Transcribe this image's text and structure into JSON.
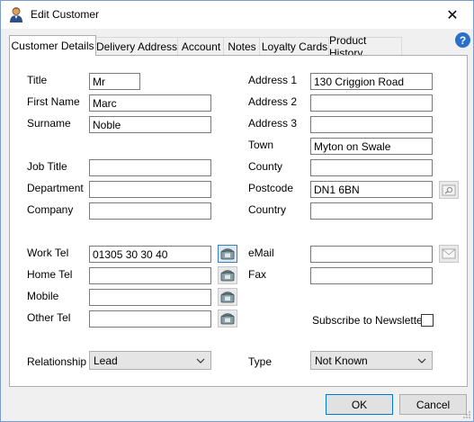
{
  "window": {
    "title": "Edit Customer",
    "close_glyph": "✕",
    "help_glyph": "?"
  },
  "tabs": [
    {
      "label": "Customer Details",
      "active": true
    },
    {
      "label": "Delivery Address"
    },
    {
      "label": "Account"
    },
    {
      "label": "Notes"
    },
    {
      "label": "Loyalty Cards"
    },
    {
      "label": "Product History"
    }
  ],
  "left_fields": {
    "title": {
      "label": "Title",
      "value": "Mr"
    },
    "first_name": {
      "label": "First Name",
      "value": "Marc"
    },
    "surname": {
      "label": "Surname",
      "value": "Noble"
    },
    "job_title": {
      "label": "Job Title",
      "value": ""
    },
    "department": {
      "label": "Department",
      "value": ""
    },
    "company": {
      "label": "Company",
      "value": ""
    },
    "work_tel": {
      "label": "Work Tel",
      "value": "01305 30 30 40"
    },
    "home_tel": {
      "label": "Home Tel",
      "value": ""
    },
    "mobile": {
      "label": "Mobile",
      "value": ""
    },
    "other_tel": {
      "label": "Other Tel",
      "value": ""
    },
    "relationship": {
      "label": "Relationship",
      "value": "Lead"
    }
  },
  "right_fields": {
    "address1": {
      "label": "Address 1",
      "value": "130 Criggion Road"
    },
    "address2": {
      "label": "Address 2",
      "value": ""
    },
    "address3": {
      "label": "Address 3",
      "value": ""
    },
    "town": {
      "label": "Town",
      "value": "Myton on Swale"
    },
    "county": {
      "label": "County",
      "value": ""
    },
    "postcode": {
      "label": "Postcode",
      "value": "DN1 6BN"
    },
    "country": {
      "label": "Country",
      "value": ""
    },
    "email": {
      "label": "eMail",
      "value": ""
    },
    "fax": {
      "label": "Fax",
      "value": ""
    },
    "newsletter": {
      "label": "Subscribe to Newsletter",
      "checked": false
    },
    "type": {
      "label": "Type",
      "value": "Not Known"
    }
  },
  "buttons": {
    "ok": "OK",
    "cancel": "Cancel"
  },
  "icons": {
    "app": "user-icon",
    "phone": "telephone-icon",
    "postcode_lookup": "postcode-lookup-icon",
    "email": "envelope-icon"
  },
  "colors": {
    "accent": "#0078d7",
    "panel": "#ffffff",
    "window_bg": "#f0f0f0"
  }
}
